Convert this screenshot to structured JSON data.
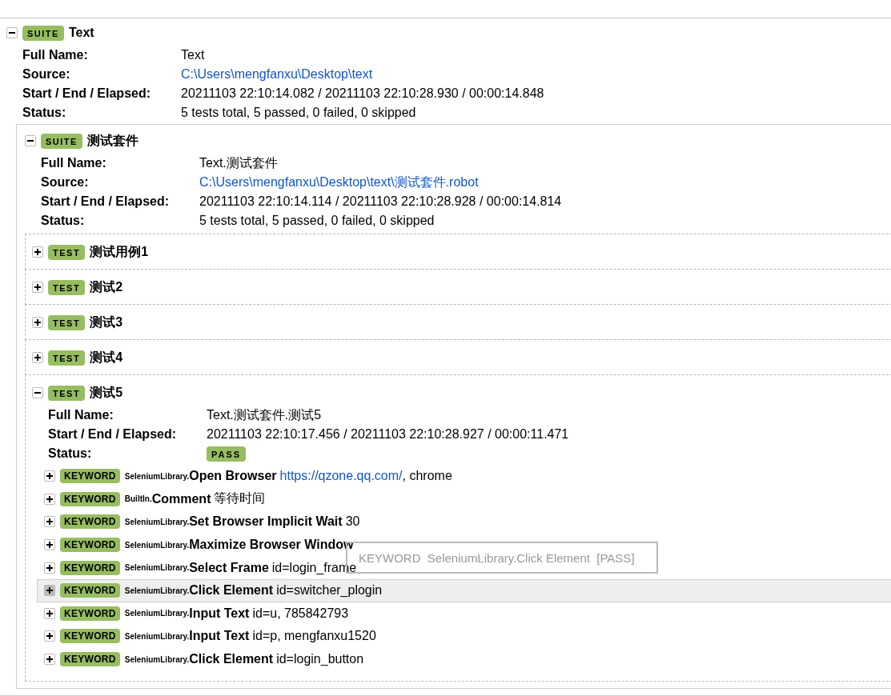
{
  "suite": {
    "badge": "SUITE",
    "name": "Text",
    "expanded": true,
    "meta": [
      {
        "label": "Full Name:",
        "parts": [
          {
            "kind": "text",
            "text": "Text"
          }
        ]
      },
      {
        "label": "Source:",
        "parts": [
          {
            "kind": "link",
            "text": "C:\\Users\\mengfanxu\\Desktop\\text"
          }
        ]
      },
      {
        "label": "Start / End / Elapsed:",
        "parts": [
          {
            "kind": "text",
            "text": "20211103 22:10:14.082 / 20211103 22:10:28.930 / 00:00:14.848"
          }
        ]
      },
      {
        "label": "Status:",
        "parts": [
          {
            "kind": "text",
            "text": "5 tests total, 5 passed, 0 failed, 0 skipped"
          }
        ]
      }
    ],
    "suites": [
      {
        "badge": "SUITE",
        "name": "测试套件",
        "expanded": true,
        "meta": [
          {
            "label": "Full Name:",
            "parts": [
              {
                "kind": "text",
                "text": "Text.测试套件"
              }
            ]
          },
          {
            "label": "Source:",
            "parts": [
              {
                "kind": "link",
                "text": "C:\\Users\\mengfanxu\\Desktop\\text\\测试套件.robot"
              }
            ]
          },
          {
            "label": "Start / End / Elapsed:",
            "parts": [
              {
                "kind": "text",
                "text": "20211103 22:10:14.114 / 20211103 22:10:28.928 / 00:00:14.814"
              }
            ]
          },
          {
            "label": "Status:",
            "parts": [
              {
                "kind": "text",
                "text": "5 tests total, 5 passed, 0 failed, 0 skipped"
              }
            ]
          }
        ],
        "tests": [
          {
            "badge": "TEST",
            "name": "测试用例1",
            "expanded": false
          },
          {
            "badge": "TEST",
            "name": "测试2",
            "expanded": false
          },
          {
            "badge": "TEST",
            "name": "测试3",
            "expanded": false
          },
          {
            "badge": "TEST",
            "name": "测试4",
            "expanded": false
          },
          {
            "badge": "TEST",
            "name": "测试5",
            "expanded": true,
            "meta": [
              {
                "label": "Full Name:",
                "parts": [
                  {
                    "kind": "text",
                    "text": "Text.测试套件.测试5"
                  }
                ]
              },
              {
                "label": "Start / End / Elapsed:",
                "parts": [
                  {
                    "kind": "text",
                    "text": "20211103 22:10:17.456 / 20211103 22:10:28.927 / 00:00:11.471"
                  }
                ]
              },
              {
                "label": "Status:",
                "parts": [
                  {
                    "kind": "badge",
                    "text": "PASS"
                  }
                ]
              }
            ],
            "keywords": [
              {
                "badge": "KEYWORD",
                "library": "SeleniumLibrary.",
                "name": "Open Browser",
                "expanded": false,
                "highlighted": false,
                "args": [
                  {
                    "kind": "link",
                    "text": "https://qzone.qq.com/"
                  },
                  {
                    "kind": "text",
                    "text": ", chrome"
                  }
                ]
              },
              {
                "badge": "KEYWORD",
                "library": "BuiltIn.",
                "name": "Comment",
                "expanded": false,
                "highlighted": false,
                "args": [
                  {
                    "kind": "text",
                    "text": "等待时间"
                  }
                ]
              },
              {
                "badge": "KEYWORD",
                "library": "SeleniumLibrary.",
                "name": "Set Browser Implicit Wait",
                "expanded": false,
                "highlighted": false,
                "args": [
                  {
                    "kind": "text",
                    "text": "30"
                  }
                ]
              },
              {
                "badge": "KEYWORD",
                "library": "SeleniumLibrary.",
                "name": "Maximize Browser Window",
                "expanded": false,
                "highlighted": false
              },
              {
                "badge": "KEYWORD",
                "library": "SeleniumLibrary.",
                "name": "Select Frame",
                "expanded": false,
                "highlighted": false,
                "args": [
                  {
                    "kind": "text",
                    "text": "id=login_frame"
                  }
                ]
              },
              {
                "badge": "KEYWORD",
                "library": "SeleniumLibrary.",
                "name": "Click Element",
                "expanded": false,
                "highlighted": true,
                "args": [
                  {
                    "kind": "text",
                    "text": "id=switcher_plogin"
                  }
                ]
              },
              {
                "badge": "KEYWORD",
                "library": "SeleniumLibrary.",
                "name": "Input Text",
                "expanded": false,
                "highlighted": false,
                "args": [
                  {
                    "kind": "text",
                    "text": "id=u, 785842793"
                  }
                ]
              },
              {
                "badge": "KEYWORD",
                "library": "SeleniumLibrary.",
                "name": "Input Text",
                "expanded": false,
                "highlighted": false,
                "args": [
                  {
                    "kind": "text",
                    "text": "id=p, mengfanxu1520"
                  }
                ]
              },
              {
                "badge": "KEYWORD",
                "library": "SeleniumLibrary.",
                "name": "Click Element",
                "expanded": false,
                "highlighted": false,
                "args": [
                  {
                    "kind": "text",
                    "text": "id=login_button"
                  }
                ]
              }
            ],
            "tooltip": "KEYWORD  SeleniumLibrary.Click Element  [PASS]"
          }
        ]
      }
    ]
  }
}
